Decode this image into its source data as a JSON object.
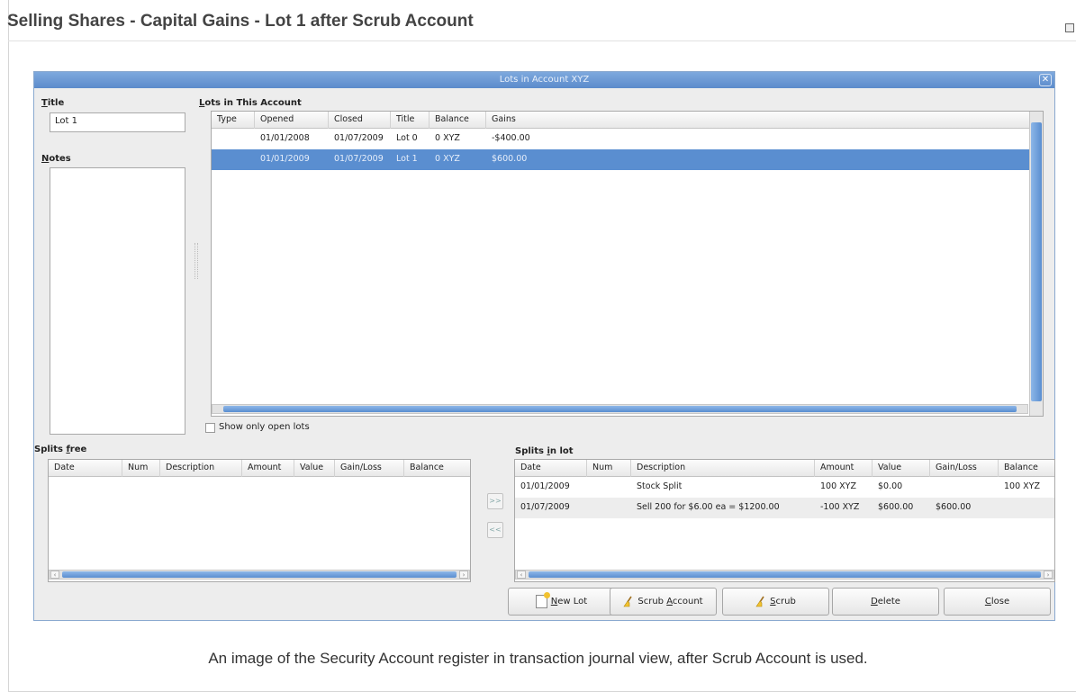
{
  "page": {
    "title": "Selling Shares - Capital Gains - Lot 1 after Scrub Account",
    "caption": "An image of the Security Account register in transaction journal view, after Scrub Account is used."
  },
  "dialog": {
    "title": "Lots in Account XYZ",
    "close_icon": "close-icon",
    "title_label": {
      "u": "T",
      "rest": "itle"
    },
    "title_value": "Lot 1",
    "notes_label": {
      "u": "N",
      "rest": "otes"
    },
    "lots_label": {
      "u": "L",
      "rest": "ots in This Account"
    },
    "lots_columns": [
      "Type",
      "Opened",
      "Closed",
      "Title",
      "Balance",
      "Gains"
    ],
    "lots_rows": [
      {
        "type": "",
        "opened": "01/01/2008",
        "closed": "01/07/2009",
        "title": "Lot 0",
        "balance": "0 XYZ",
        "gains": "-$400.00",
        "selected": false
      },
      {
        "type": "",
        "opened": "01/01/2009",
        "closed": "01/07/2009",
        "title": "Lot 1",
        "balance": "0 XYZ",
        "gains": "$600.00",
        "selected": true
      }
    ],
    "show_open_lots_label": "Show only open lots",
    "show_open_lots_checked": false,
    "splits_free_label": {
      "pre": "Splits ",
      "u": "f",
      "rest": "ree"
    },
    "splits_free_columns": [
      "Date",
      "Num",
      "Description",
      "Amount",
      "Value",
      "Gain/Loss",
      "Balance"
    ],
    "splits_in_lot_label": {
      "pre": "Splits ",
      "u": "i",
      "rest": "n lot"
    },
    "splits_in_lot_columns": [
      "Date",
      "Num",
      "Description",
      "Amount",
      "Value",
      "Gain/Loss",
      "Balance"
    ],
    "splits_in_lot_rows": [
      {
        "date": "01/01/2009",
        "num": "",
        "description": "Stock Split",
        "amount": "100 XYZ",
        "value": "$0.00",
        "gain_loss": "",
        "balance": "100 XYZ"
      },
      {
        "date": "01/07/2009",
        "num": "",
        "description": "Sell 200 for $6.00 ea = $1200.00",
        "amount": "-100 XYZ",
        "value": "$600.00",
        "gain_loss": "$600.00",
        "balance": ""
      }
    ],
    "move_to_lot_label": ">>",
    "move_from_lot_label": "<<",
    "buttons": {
      "new_lot": {
        "u": "N",
        "rest": "ew Lot",
        "icon": "new-lot-icon"
      },
      "scrub_account": {
        "pre": "Scrub ",
        "u": "A",
        "rest": "ccount",
        "icon": "broom-icon"
      },
      "scrub": {
        "u": "S",
        "rest": "crub",
        "icon": "broom-icon"
      },
      "delete": {
        "u": "D",
        "rest": "elete"
      },
      "close": {
        "u": "C",
        "rest": "lose"
      }
    },
    "colors": {
      "selection": "#5a8ed0",
      "titlebar": "#6b9ad6"
    }
  }
}
